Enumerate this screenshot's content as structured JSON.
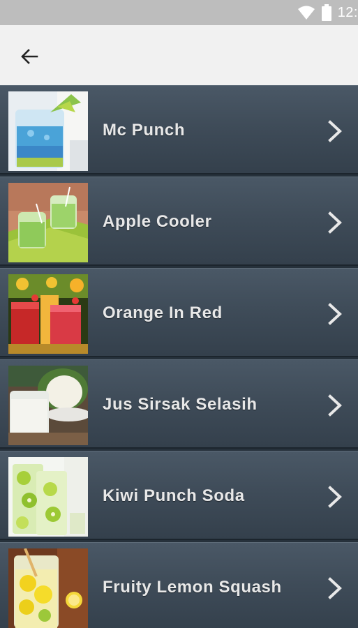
{
  "status_bar": {
    "time": "12:",
    "icons": [
      "wifi-icon",
      "battery-icon"
    ]
  },
  "app_bar": {
    "back_icon": "arrow-left-icon"
  },
  "list": {
    "items": [
      {
        "label": "Mc Punch",
        "image": "blue-punch-drink-photo"
      },
      {
        "label": "Apple Cooler",
        "image": "green-apple-drink-photo"
      },
      {
        "label": "Orange In Red",
        "image": "red-orange-drinks-photo"
      },
      {
        "label": "Jus Sirsak Selasih",
        "image": "soursop-juice-photo"
      },
      {
        "label": "Kiwi Punch Soda",
        "image": "kiwi-soda-photo"
      },
      {
        "label": "Fruity Lemon Squash",
        "image": "lemon-squash-photo"
      }
    ],
    "chevron_icon": "chevron-right-icon"
  }
}
